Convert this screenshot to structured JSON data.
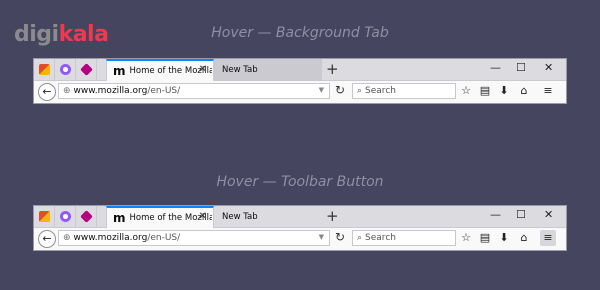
{
  "logo": {
    "part1": "digi",
    "part2": "kala"
  },
  "captions": {
    "top": "Hover — Background Tab",
    "bottom": "Hover — Toolbar Button"
  },
  "browser": {
    "active_tab_title": "Home of the Mozilla...",
    "background_tab_title": "New Tab",
    "new_tab_label": "+",
    "url_domain": "www.mozilla.org",
    "url_path": "/en-US/",
    "search_placeholder": "Search",
    "window_controls": {
      "minimize": "—",
      "restore": "☐",
      "close": "✕"
    },
    "icons": {
      "back": "←",
      "globe": "⊕",
      "dropdown": "▼",
      "reload": "↻",
      "search": "⌕",
      "bookmark": "☆",
      "library": "▤",
      "downloads": "⬇",
      "home": "⌂",
      "menu": "≡",
      "tab_close": "✕",
      "mozilla_m": "m"
    }
  },
  "colors": {
    "accent": "#0a84ff",
    "brand": "#ef394e"
  }
}
